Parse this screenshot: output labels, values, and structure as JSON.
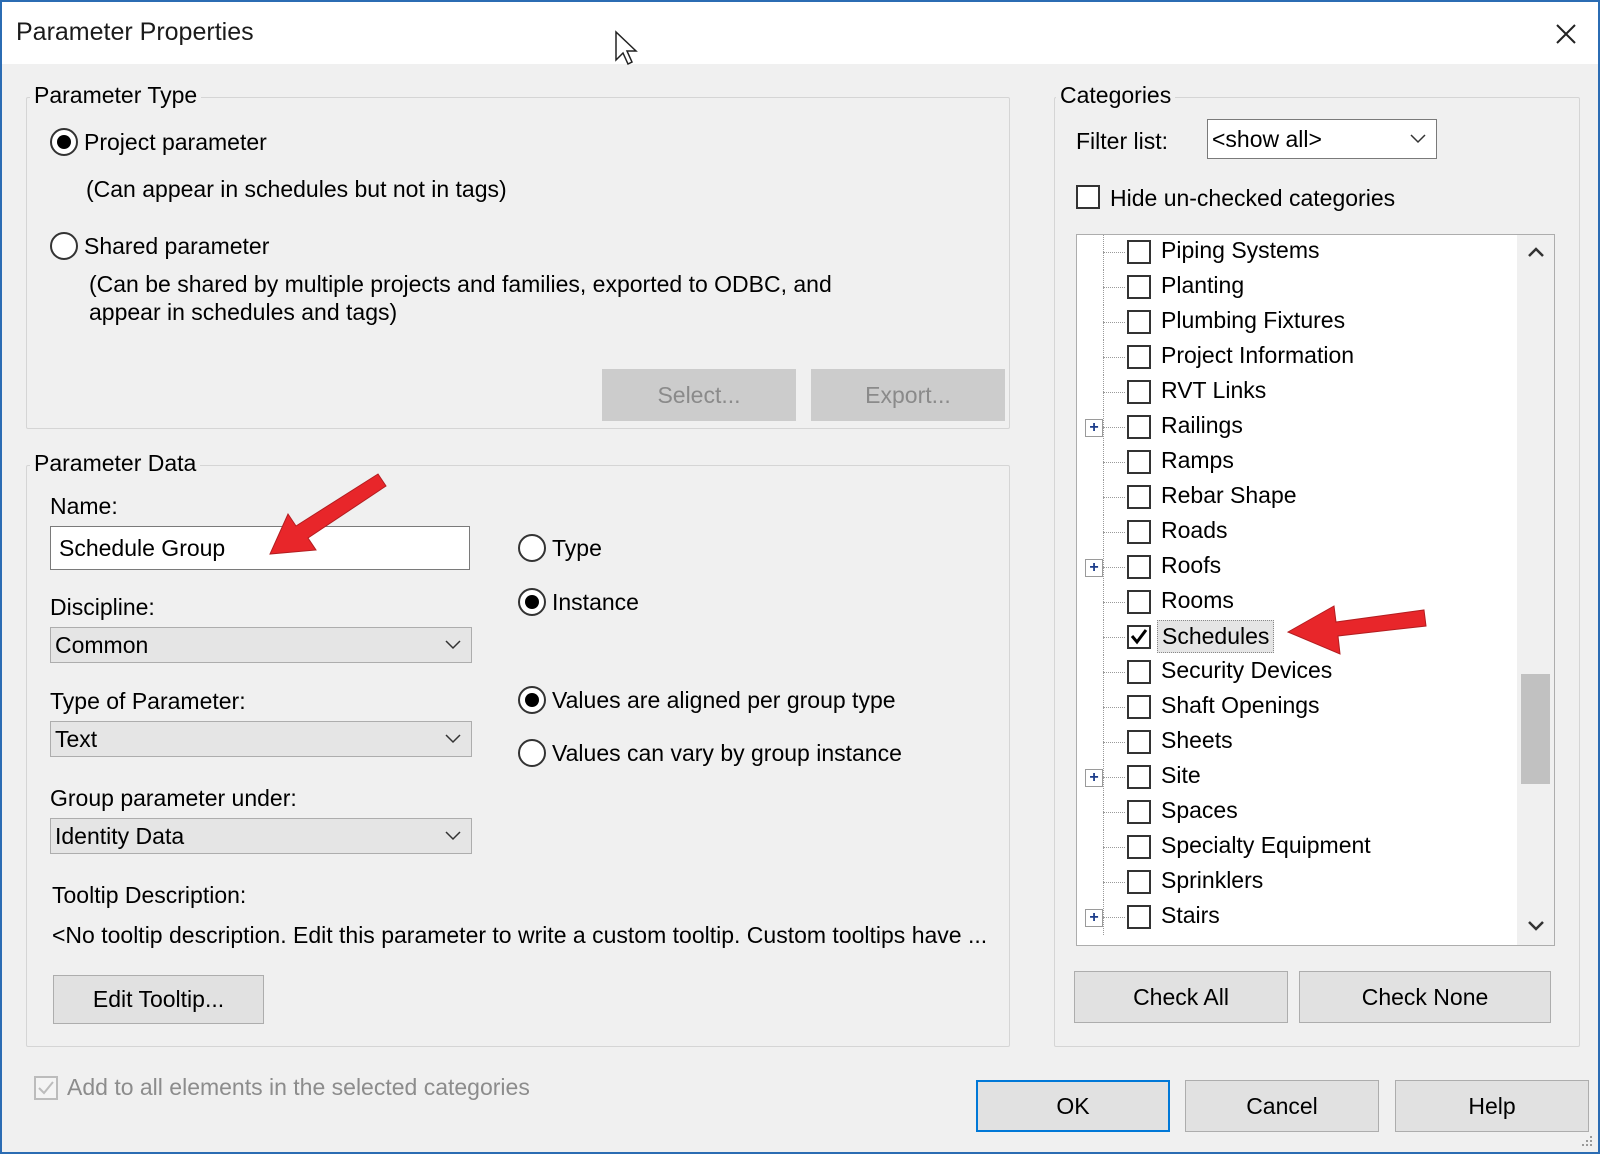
{
  "window": {
    "title": "Parameter Properties"
  },
  "parameter_type": {
    "label": "Parameter Type",
    "project_label": "Project parameter",
    "project_desc": "(Can appear in schedules but not in tags)",
    "shared_label": "Shared parameter",
    "shared_desc_1": "(Can be shared by multiple projects and families, exported to ODBC, and",
    "shared_desc_2": "appear in schedules and tags)",
    "selected": "Project parameter",
    "select_button": "Select...",
    "export_button": "Export..."
  },
  "parameter_data": {
    "label": "Parameter Data",
    "name_label": "Name:",
    "name_value": "Schedule Group",
    "discipline_label": "Discipline:",
    "discipline_value": "Common",
    "type_label": "Type of Parameter:",
    "type_value": "Text",
    "group_label": "Group parameter under:",
    "group_value": "Identity Data",
    "radio_type": "Type",
    "radio_instance": "Instance",
    "instance_selected": "Instance",
    "radio_aligned": "Values are aligned per group type",
    "radio_vary": "Values can vary by group instance",
    "group_mode_selected": "Values are aligned per group type",
    "tooltip_label": "Tooltip Description:",
    "tooltip_value": "<No tooltip description. Edit this parameter to write a custom tooltip. Custom tooltips have ...",
    "edit_tooltip_button": "Edit Tooltip..."
  },
  "categories": {
    "label": "Categories",
    "filter_label": "Filter list:",
    "filter_value": "<show all>",
    "hide_unchecked_label": "Hide un-checked categories",
    "items": [
      {
        "label": "Piping Systems",
        "checked": false,
        "expandable": false
      },
      {
        "label": "Planting",
        "checked": false,
        "expandable": false
      },
      {
        "label": "Plumbing Fixtures",
        "checked": false,
        "expandable": false
      },
      {
        "label": "Project Information",
        "checked": false,
        "expandable": false
      },
      {
        "label": "RVT Links",
        "checked": false,
        "expandable": false
      },
      {
        "label": "Railings",
        "checked": false,
        "expandable": true
      },
      {
        "label": "Ramps",
        "checked": false,
        "expandable": false
      },
      {
        "label": "Rebar Shape",
        "checked": false,
        "expandable": false
      },
      {
        "label": "Roads",
        "checked": false,
        "expandable": false
      },
      {
        "label": "Roofs",
        "checked": false,
        "expandable": true
      },
      {
        "label": "Rooms",
        "checked": false,
        "expandable": false
      },
      {
        "label": "Schedules",
        "checked": true,
        "expandable": false,
        "selected": true
      },
      {
        "label": "Security Devices",
        "checked": false,
        "expandable": false
      },
      {
        "label": "Shaft Openings",
        "checked": false,
        "expandable": false
      },
      {
        "label": "Sheets",
        "checked": false,
        "expandable": false
      },
      {
        "label": "Site",
        "checked": false,
        "expandable": true
      },
      {
        "label": "Spaces",
        "checked": false,
        "expandable": false
      },
      {
        "label": "Specialty Equipment",
        "checked": false,
        "expandable": false
      },
      {
        "label": "Sprinklers",
        "checked": false,
        "expandable": false
      },
      {
        "label": "Stairs",
        "checked": false,
        "expandable": true
      }
    ],
    "check_all_button": "Check All",
    "check_none_button": "Check None"
  },
  "footer": {
    "add_to_all_label": "Add to all elements in the selected categories",
    "ok_button": "OK",
    "cancel_button": "Cancel",
    "help_button": "Help"
  },
  "colors": {
    "accent": "#0078d7",
    "annotation_arrow": "#e8262a"
  }
}
